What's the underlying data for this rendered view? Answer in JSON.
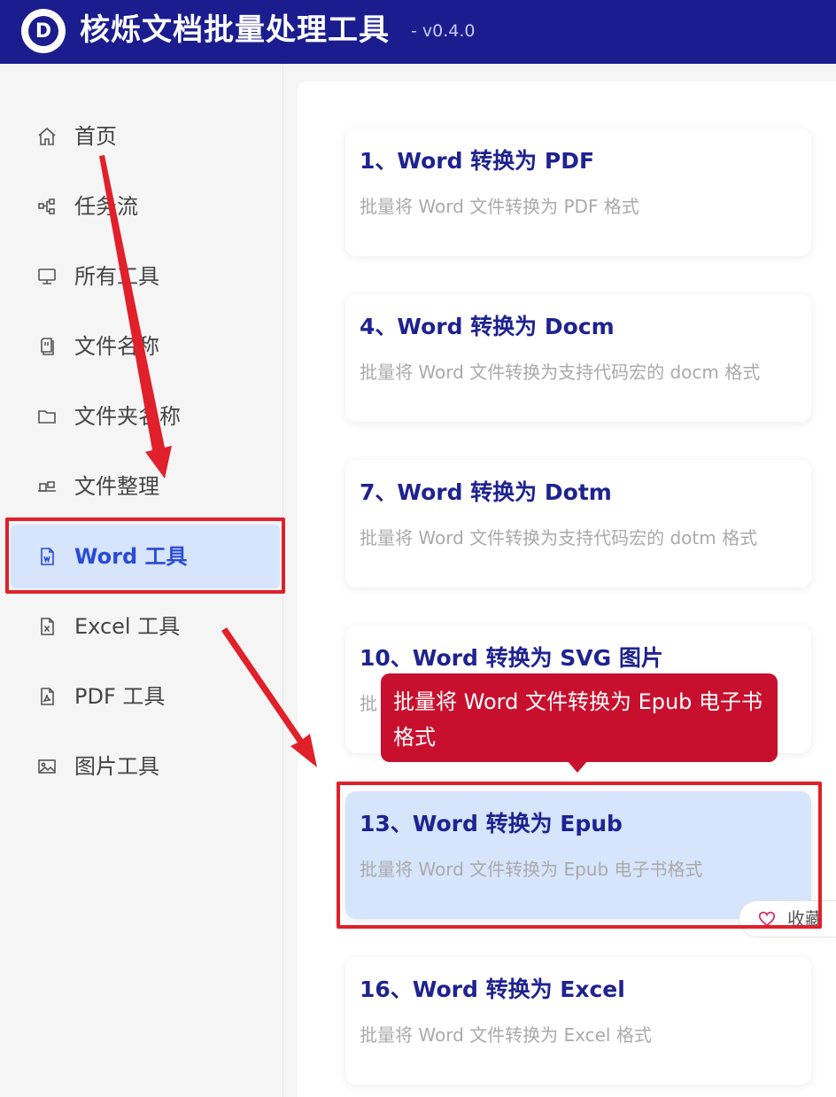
{
  "header": {
    "logo_letter": "D",
    "title": "核烁文档批量处理工具",
    "version": "- v0.4.0"
  },
  "sidebar": {
    "items": [
      {
        "label": "首页",
        "icon": "home-icon"
      },
      {
        "label": "任务流",
        "icon": "workflow-icon"
      },
      {
        "label": "所有工具",
        "icon": "monitor-icon"
      },
      {
        "label": "文件名称",
        "icon": "file-copy-icon"
      },
      {
        "label": "文件夹名称",
        "icon": "folder-icon"
      },
      {
        "label": "文件整理",
        "icon": "organize-icon"
      },
      {
        "label": "Word 工具",
        "icon": "word-file-icon",
        "active": true
      },
      {
        "label": "Excel 工具",
        "icon": "excel-file-icon"
      },
      {
        "label": "PDF 工具",
        "icon": "pdf-file-icon"
      },
      {
        "label": "图片工具",
        "icon": "image-icon"
      }
    ]
  },
  "cards": [
    {
      "title": "1、Word 转换为 PDF",
      "desc": "批量将 Word 文件转换为 PDF 格式"
    },
    {
      "title": "4、Word 转换为 Docm",
      "desc": "批量将 Word 文件转换为支持代码宏的 docm 格式"
    },
    {
      "title": "7、Word 转换为 Dotm",
      "desc": "批量将 Word 文件转换为支持代码宏的 dotm 格式"
    },
    {
      "title": "10、Word 转换为 SVG 图片",
      "desc": "批"
    },
    {
      "title": "13、Word 转换为 Epub",
      "desc": "批量将 Word 文件转换为 Epub 电子书格式"
    },
    {
      "title": "16、Word 转换为 Excel",
      "desc": "批量将 Word 文件转换为 Excel 格式"
    }
  ],
  "tooltip": {
    "text": "批量将 Word 文件转换为 Epub 电子书格式"
  },
  "favorite": {
    "label": "收藏",
    "icon": "heart-icon"
  },
  "colors": {
    "header_bg": "#1b1d8f",
    "accent": "#2a4bd6",
    "card_title": "#1e2390",
    "tooltip_bg": "#c8102e",
    "annotation_red": "#e0202a",
    "active_bg": "#d6e4fc"
  }
}
